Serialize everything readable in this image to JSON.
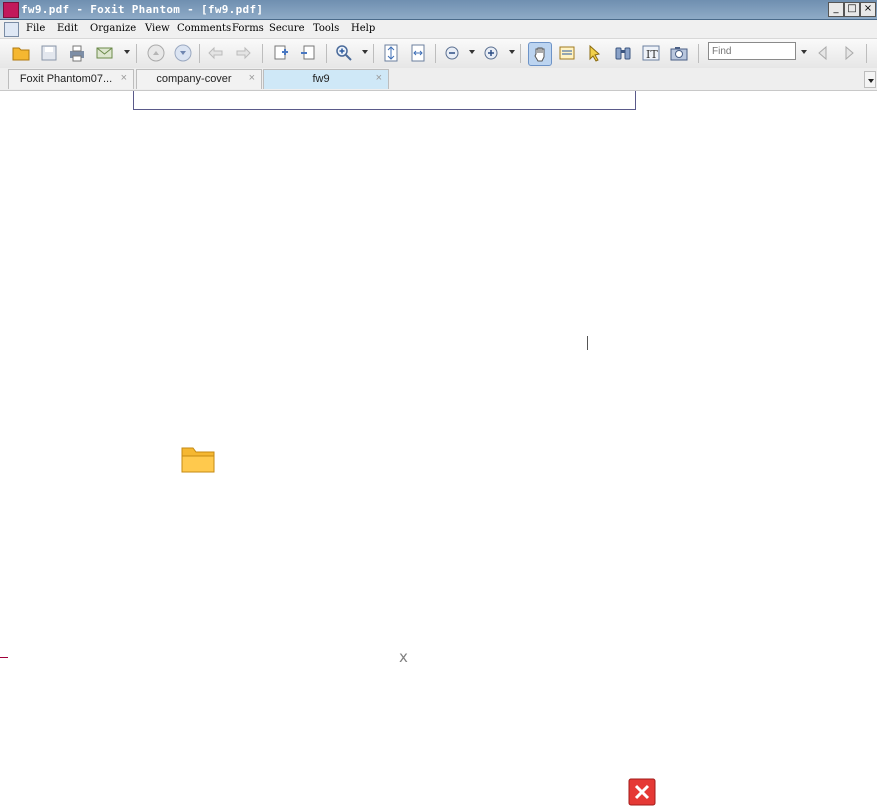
{
  "window": {
    "title": "fw9.pdf - Foxit Phantom - [fw9.pdf]",
    "controls": [
      "_",
      "□",
      "×"
    ]
  },
  "menu": {
    "items": [
      "File",
      "Edit",
      "Organize",
      "View",
      "Comments",
      "Forms",
      "Secure",
      "Tools",
      "Help"
    ]
  },
  "toolbar": {
    "buttons": [
      "open-icon",
      "save-icon",
      "print-icon",
      "email-icon",
      "scroll-up-icon",
      "scroll-down-icon",
      "back-arrow-icon",
      "forward-arrow-icon",
      "insert-page-icon",
      "extract-page-icon",
      "zoom-in-icon",
      "fit-page-icon",
      "fit-width-icon",
      "zoom-out-minus-icon",
      "zoom-in-plus-icon",
      "hand-tool-icon",
      "typewriter-icon",
      "select-arrow-icon",
      "binoculars-icon",
      "text-select-icon",
      "snapshot-camera-icon",
      "find-prev-icon",
      "find-next-icon"
    ],
    "find_placeholder": "Find"
  },
  "tabs": [
    {
      "label": "Foxit Phantom07...",
      "active": false
    },
    {
      "label": "company-cover",
      "active": false
    },
    {
      "label": "fw9",
      "active": true
    }
  ],
  "tab_close_glyph": "×",
  "content": {
    "gray_x": "x"
  },
  "colors": {
    "title_bar": "#7f9cbc",
    "active_tab": "#cfe8f7",
    "folder": "#f5b731",
    "close_red": "#e53935"
  }
}
